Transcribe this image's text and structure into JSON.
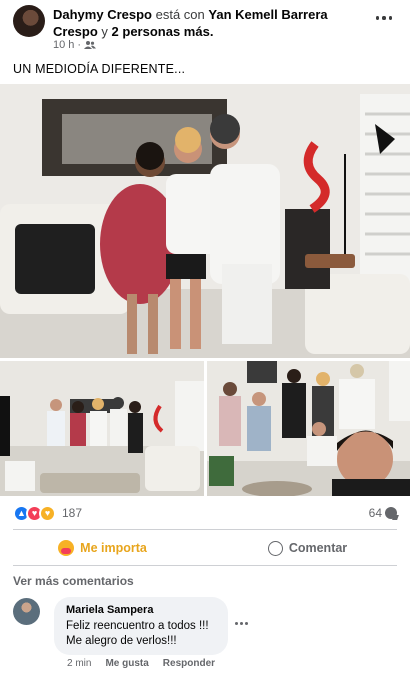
{
  "post": {
    "author": "Dahymy Crespo",
    "connector": "está con",
    "tagged": "Yan Kemell Barrera Crespo",
    "and": "y",
    "others": "2 personas más.",
    "time": "10 h",
    "audience_icon": "friends-icon",
    "caption": "UN MEDIODÍA DIFERENTE..."
  },
  "reactions": {
    "count": "187",
    "types": [
      "like",
      "love",
      "care"
    ],
    "comments": "64"
  },
  "actions": {
    "react_label": "Me importa",
    "comment_label": "Comentar"
  },
  "comments_section": {
    "more_label": "Ver más comentarios",
    "items": [
      {
        "author": "Mariela Sampera",
        "line1": "Feliz reencuentro a todos !!!",
        "line2": "Me alegro de verlos!!!",
        "time": "2 min",
        "like": "Me gusta",
        "reply": "Responder"
      }
    ]
  },
  "colors": {
    "accent_blue": "#1877f2",
    "care_yellow": "#e8a51c",
    "muted": "#65676b"
  }
}
